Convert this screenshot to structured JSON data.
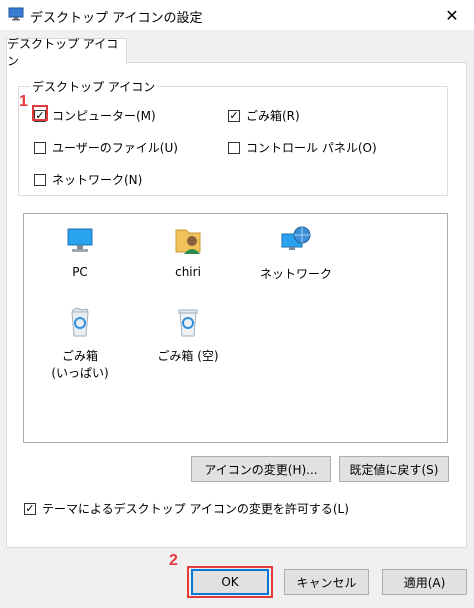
{
  "window": {
    "title": "デスクトップ アイコンの設定",
    "close_glyph": "✕"
  },
  "tab": {
    "label": "デスクトップ アイコン"
  },
  "group": {
    "title": "デスクトップ アイコン",
    "checkboxes": [
      {
        "label": "コンピューター(M)",
        "checked": true
      },
      {
        "label": "ごみ箱(R)",
        "checked": true
      },
      {
        "label": "ユーザーのファイル(U)",
        "checked": false
      },
      {
        "label": "コントロール パネル(O)",
        "checked": false
      },
      {
        "label": "ネットワーク(N)",
        "checked": false
      }
    ]
  },
  "icons": [
    {
      "label": "PC",
      "icon": "pc-icon"
    },
    {
      "label": "chiri",
      "icon": "user-folder-icon"
    },
    {
      "label": "ネットワーク",
      "icon": "network-icon"
    },
    {
      "label": "ごみ箱\n(いっぱい)",
      "icon": "recycle-bin-full-icon"
    },
    {
      "label": "ごみ箱 (空)",
      "icon": "recycle-bin-empty-icon"
    }
  ],
  "buttons": {
    "change_icon": "アイコンの変更(H)...",
    "restore_default": "既定値に戻す(S)",
    "ok": "OK",
    "cancel": "キャンセル",
    "apply": "適用(A)"
  },
  "theme_checkbox": {
    "label": "テーマによるデスクトップ アイコンの変更を許可する(L)",
    "checked": true
  },
  "markers": {
    "one": "1",
    "two": "2"
  },
  "colors": {
    "accent": "#0078d7",
    "highlight": "#e53a3a"
  }
}
